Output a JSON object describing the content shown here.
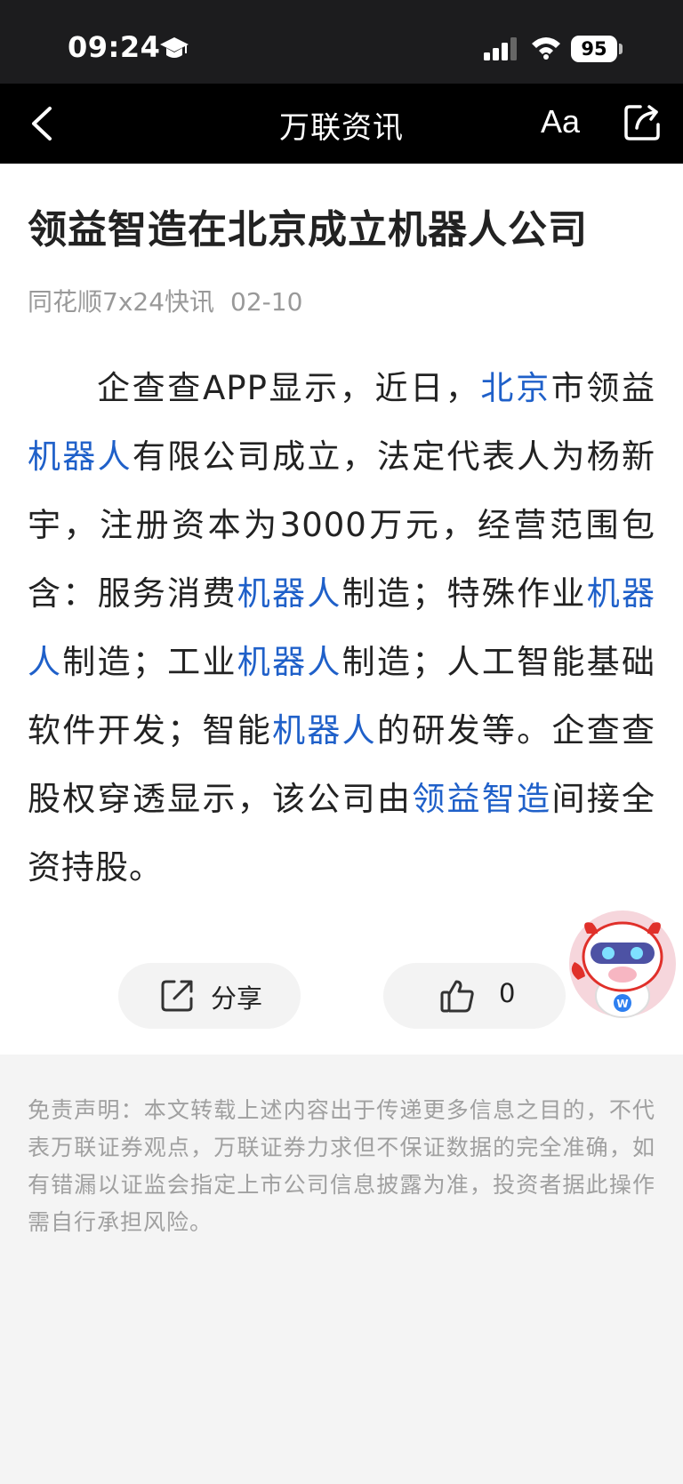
{
  "status_bar": {
    "time": "09:24",
    "battery": "95"
  },
  "nav": {
    "title": "万联资讯",
    "font_toggle": "Aa"
  },
  "article": {
    "title": "领益智造在北京成立机器人公司",
    "source": "同花顺7x24快讯",
    "date": "02-10",
    "body": [
      {
        "text": "企查查APP显示，近日，",
        "link": false
      },
      {
        "text": "北京",
        "link": true
      },
      {
        "text": "市领益",
        "link": false
      },
      {
        "text": "机器人",
        "link": true
      },
      {
        "text": "有限公司成立，法定代表人为杨新宇，注册资本为3000万元，经营范围包含：服务消费",
        "link": false
      },
      {
        "text": "机器人",
        "link": true
      },
      {
        "text": "制造；特殊作业",
        "link": false
      },
      {
        "text": "机器人",
        "link": true
      },
      {
        "text": "制造；工业",
        "link": false
      },
      {
        "text": "机器人",
        "link": true
      },
      {
        "text": "制造；人工智能基础软件开发；智能",
        "link": false
      },
      {
        "text": "机器人",
        "link": true
      },
      {
        "text": "的研发等。企查查股权穿透显示，该公司由",
        "link": false
      },
      {
        "text": "领益智造",
        "link": true
      },
      {
        "text": "间接全资持股。",
        "link": false
      }
    ]
  },
  "actions": {
    "share_label": "分享",
    "like_count": "0"
  },
  "disclaimer": "免责声明：本文转载上述内容出于传递更多信息之目的，不代表万联证券观点，万联证券力求但不保证数据的完全准确，如有错漏以证监会指定上市公司信息披露为准，投资者据此操作需自行承担风险。",
  "colors": {
    "link": "#1f60c9",
    "nav_background": "#000000",
    "page_background": "#f4f4f4"
  },
  "icons": [
    "graduation-cap-icon",
    "cellular-signal-icon",
    "wifi-icon",
    "back-chevron-icon",
    "share-icon",
    "external-share-icon",
    "thumbs-up-icon"
  ]
}
